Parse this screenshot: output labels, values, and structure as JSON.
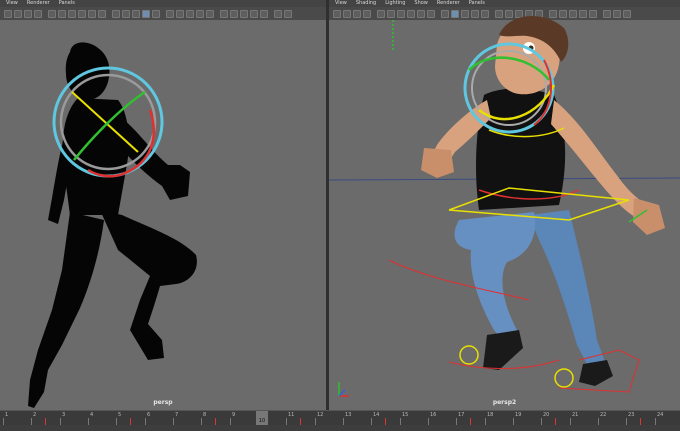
{
  "left_viewport": {
    "menu": [
      "View",
      "Renderer",
      "Panels"
    ],
    "camera_label": "persp"
  },
  "right_viewport": {
    "menu": [
      "View",
      "Shading",
      "Lighting",
      "Show",
      "Renderer",
      "Panels"
    ],
    "camera_label": "persp2"
  },
  "timeline": {
    "frames": [
      "1",
      "2",
      "3",
      "4",
      "5",
      "6",
      "7",
      "8",
      "9",
      "10",
      "11",
      "12",
      "13",
      "14",
      "15",
      "16",
      "17",
      "18",
      "19",
      "20",
      "21",
      "22",
      "23",
      "24"
    ],
    "current_frame": "10"
  },
  "colors": {
    "viewport_bg": "#6b6b6b",
    "ctrl_cyan": "#5fc8e0",
    "ctrl_yellow": "#e8e000",
    "ctrl_red": "#e03030",
    "ctrl_green": "#30c030",
    "shirt": "#111111",
    "jeans": "#5a86b8"
  }
}
